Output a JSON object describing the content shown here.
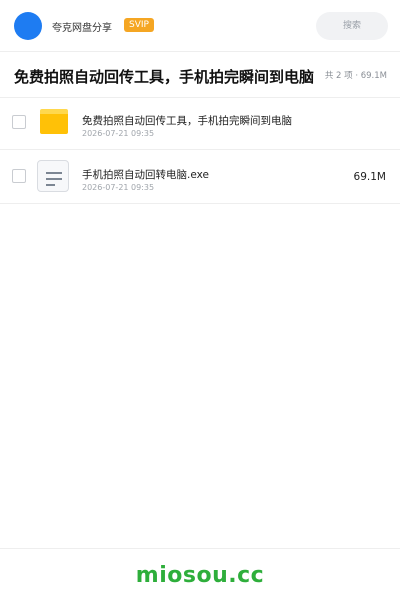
{
  "header": {
    "user_name": "夸克网盘分享",
    "vip_badge": "SVIP",
    "search_placeholder": "搜索",
    "accent_color": "#1e7cf2"
  },
  "share": {
    "title": "免费拍照自动回传工具，手机拍完瞬间到电脑",
    "summary": "共 2 项 · 69.1M"
  },
  "files": [
    {
      "icon": "folder-icon",
      "name": "免费拍照自动回传工具，手机拍完瞬间到电脑",
      "date": "2026-07-21 09:35",
      "size": ""
    },
    {
      "icon": "file-icon",
      "name": "手机拍照自动回转电脑.exe",
      "date": "2026-07-21 09:35",
      "size": "69.1M"
    }
  ],
  "footer": {
    "brand": "miosou.cc",
    "brand_color": "#2eae3b"
  }
}
